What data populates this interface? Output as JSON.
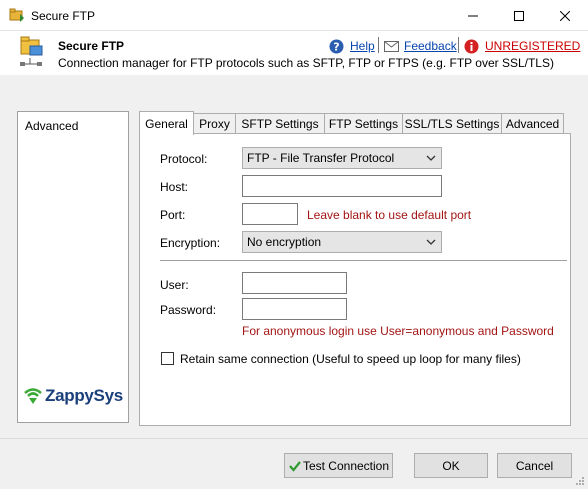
{
  "window": {
    "title": "Secure FTP",
    "icons": {
      "app": "ftp-folder-icon",
      "minimize": "minimize-icon",
      "maximize": "maximize-icon",
      "close": "close-icon"
    }
  },
  "header": {
    "title": "Secure FTP",
    "description": "Connection manager for FTP protocols such as SFTP, FTP or FTPS (e.g. FTP over SSL/TLS)",
    "help_label": "Help",
    "feedback_label": "Feedback",
    "unregistered_label": "UNREGISTERED",
    "icons": {
      "help": "help-icon",
      "feedback": "envelope-icon",
      "unregistered": "info-icon"
    }
  },
  "sidebar": {
    "items": [
      {
        "label": "Advanced"
      }
    ],
    "logo_text": "ZappySys"
  },
  "tabs": [
    {
      "label": "General",
      "active": true
    },
    {
      "label": "Proxy"
    },
    {
      "label": "SFTP Settings"
    },
    {
      "label": "FTP Settings"
    },
    {
      "label": "SSL/TLS Settings"
    },
    {
      "label": "Advanced"
    }
  ],
  "general": {
    "protocol_label": "Protocol:",
    "protocol_value": "FTP - File Transfer Protocol",
    "host_label": "Host:",
    "host_value": "",
    "port_label": "Port:",
    "port_value": "",
    "port_hint": "Leave blank to use default port",
    "encryption_label": "Encryption:",
    "encryption_value": "No encryption",
    "user_label": "User:",
    "user_value": "",
    "password_label": "Password:",
    "password_value": "",
    "anonymous_hint": "For anonymous login use User=anonymous and Password",
    "retain_label": "Retain same connection (Useful to speed up loop for many files)",
    "retain_checked": false
  },
  "footer": {
    "test_label": "Test Connection",
    "ok_label": "OK",
    "cancel_label": "Cancel"
  },
  "colors": {
    "hint": "#a31515",
    "unregistered": "#cc0000",
    "link": "#0645ad",
    "logo": "#1a3f7a",
    "logo_green": "#3aa935"
  }
}
